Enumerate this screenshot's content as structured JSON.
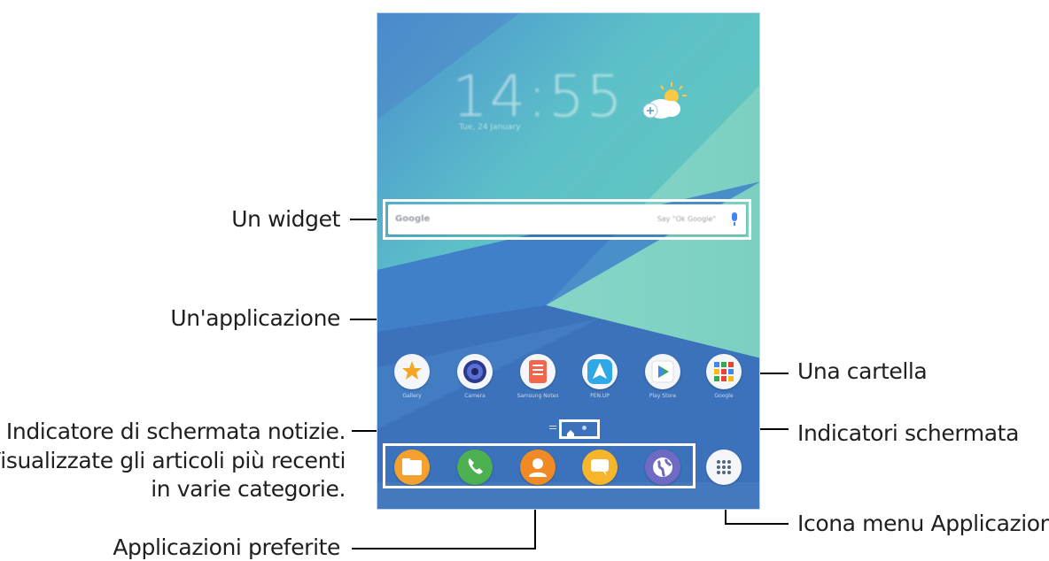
{
  "callouts": {
    "widget": "Un widget",
    "app": "Un'applicazione",
    "news_indicator_line1": "Indicatore di schermata notizie.",
    "news_indicator_line2": "Visualizzate gli articoli più recenti",
    "news_indicator_line3": "in varie categorie.",
    "favorites": "Applicazioni preferite",
    "folder": "Una cartella",
    "screen_indicators": "Indicatori schermata",
    "apps_menu_icon": "Icona menu Applicazioni"
  },
  "lock": {
    "time": "14:55",
    "date": "Tue, 24 January"
  },
  "widget": {
    "logo": "Google",
    "hint": "Say \"Ok Google\""
  },
  "apps": [
    {
      "label": "Gallery",
      "icon": "gallery-icon",
      "color": "#f5a623"
    },
    {
      "label": "Camera",
      "icon": "camera-icon",
      "color": "#5b6fd6"
    },
    {
      "label": "Samsung Notes",
      "icon": "notes-icon",
      "color": "#f2674b"
    },
    {
      "label": "PEN.UP",
      "icon": "penup-icon",
      "color": "#30a8e8"
    },
    {
      "label": "Play Store",
      "icon": "play-store-icon",
      "color": "#34a853"
    },
    {
      "label": "Google",
      "icon": "google-folder-icon",
      "color": "#ea4335"
    }
  ],
  "dock": [
    {
      "label": "My Files",
      "icon": "folder-icon",
      "color": "#f4a130"
    },
    {
      "label": "Phone",
      "icon": "phone-icon",
      "color": "#4cb050"
    },
    {
      "label": "Contacts",
      "icon": "contacts-icon",
      "color": "#f08a24"
    },
    {
      "label": "Messages",
      "icon": "messages-icon",
      "color": "#f7b52c"
    },
    {
      "label": "Internet",
      "icon": "internet-icon",
      "color": "#6f6bc4"
    },
    {
      "label": "Apps",
      "icon": "apps-grid-icon",
      "color": "#55657a"
    }
  ]
}
